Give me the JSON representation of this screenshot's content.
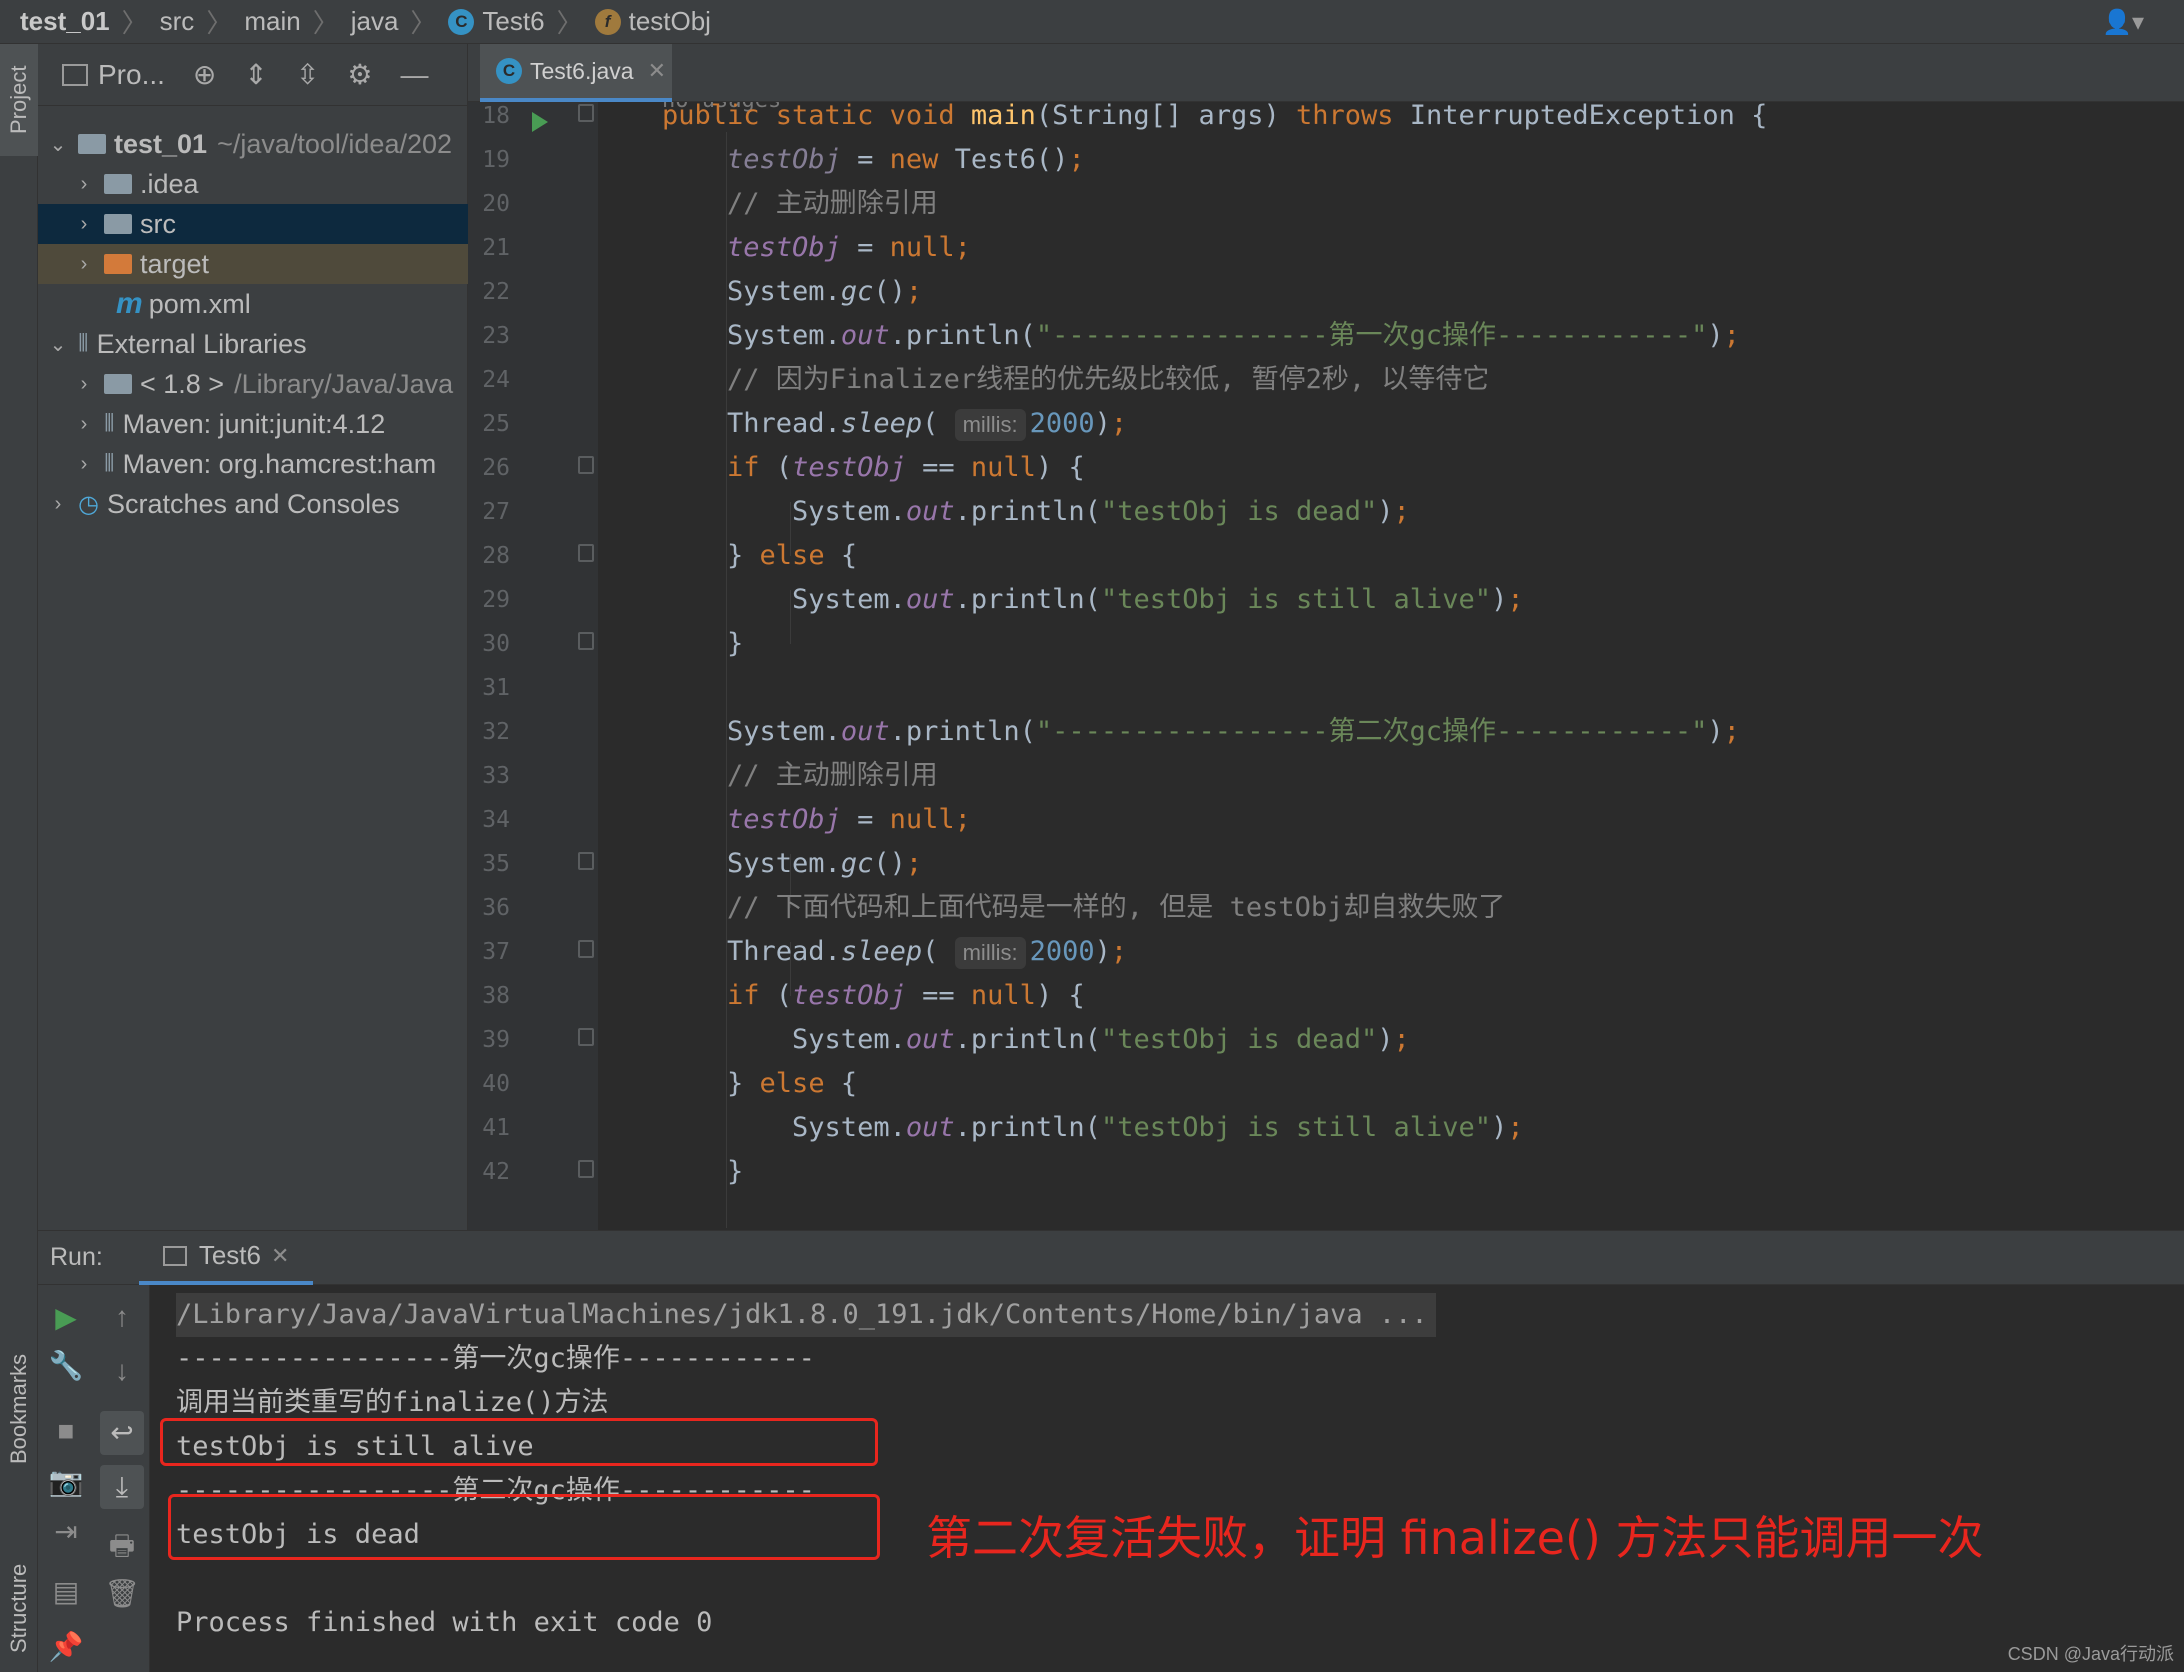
{
  "breadcrumb": [
    "test_01",
    "src",
    "main",
    "java",
    "Test6",
    "testObj"
  ],
  "left_stripe": {
    "project": "Project",
    "bookmarks": "Bookmarks",
    "structure": "Structure"
  },
  "project_panel": {
    "title": "Pro...",
    "items": [
      {
        "label": "test_01",
        "detail": "~/java/tool/idea/202"
      },
      {
        "label": ".idea"
      },
      {
        "label": "src"
      },
      {
        "label": "target"
      },
      {
        "label": "pom.xml",
        "icon_letter": "m"
      },
      {
        "label": "External Libraries"
      },
      {
        "label": "< 1.8 >",
        "detail": "/Library/Java/Java"
      },
      {
        "label": "Maven: junit:junit:4.12"
      },
      {
        "label": "Maven: org.hamcrest:ham"
      },
      {
        "label": "Scratches and Consoles"
      }
    ]
  },
  "editor_tab": {
    "label": "Test6.java"
  },
  "editor": {
    "no_usages": "no usages",
    "line_numbers": [
      "18",
      "19",
      "20",
      "21",
      "22",
      "23",
      "24",
      "25",
      "26",
      "27",
      "28",
      "29",
      "30",
      "31",
      "32",
      "33",
      "34",
      "35",
      "36",
      "37",
      "38",
      "39",
      "40",
      "41",
      "42"
    ],
    "comments": {
      "c20": "// 主动删除引用",
      "c24": "// 因为Finalizer线程的优先级比较低, 暂停2秒, 以等待它",
      "c33": "// 主动删除引用",
      "c36": "// 下面代码和上面代码是一样的, 但是 testObj却自救失败了"
    },
    "strings": {
      "s23": "\"-----------------第一次gc操作------------\"",
      "s27": "\"testObj is dead\"",
      "s29": "\"testObj is still alive\"",
      "s32": "\"-----------------第二次gc操作------------\"",
      "s39": "\"testObj is dead\"",
      "s41": "\"testObj is still alive\""
    },
    "hint_label": "millis:",
    "sleep_value": "2000"
  },
  "run_panel": {
    "label": "Run:",
    "tab": "Test6",
    "console": [
      "/Library/Java/JavaVirtualMachines/jdk1.8.0_191.jdk/Contents/Home/bin/java ...",
      "-----------------第一次gc操作------------",
      "调用当前类重写的finalize()方法",
      "testObj is still alive",
      "-----------------第二次gc操作------------",
      "testObj is dead",
      "",
      "Process finished with exit code 0"
    ]
  },
  "annotation": "第二次复活失败，证明 finalize() 方法只能调用一次",
  "watermark": "CSDN @Java行动派",
  "colors": {
    "keyword": "#cc7832",
    "string": "#6a8759",
    "number": "#6897bb",
    "comment": "#808080",
    "field": "#9876aa",
    "method": "#ffc66d",
    "highlight_box": "#e8261e",
    "selection": "#0d293e"
  }
}
